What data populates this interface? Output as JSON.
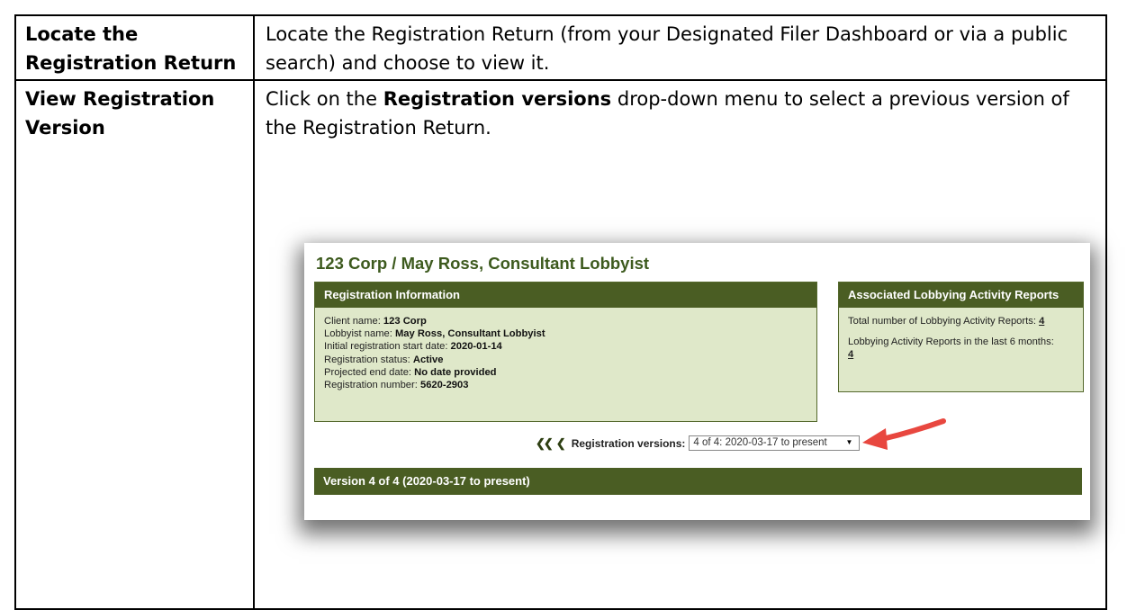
{
  "rows": [
    {
      "step": "Locate the Registration Return",
      "instruction": "Locate the Registration Return (from your Designated Filer Dashboard or via a public search) and choose to view it."
    },
    {
      "step": "View Registration Version",
      "instruction_pre": "Click on the ",
      "instruction_bold": "Registration versions",
      "instruction_post": " drop-down menu to select a previous version of the Registration Return."
    }
  ],
  "screenshot": {
    "title": "123 Corp / May Ross, Consultant Lobbyist",
    "registration_panel": {
      "heading": "Registration Information",
      "fields": [
        {
          "label": "Client name: ",
          "value": "123 Corp"
        },
        {
          "label": "Lobbyist name: ",
          "value": "May Ross, Consultant Lobbyist"
        },
        {
          "label": "Initial registration start date: ",
          "value": "2020-01-14"
        },
        {
          "label": "Registration status: ",
          "value": "Active"
        },
        {
          "label": "Projected end date: ",
          "value": "No date provided"
        },
        {
          "label": "Registration number: ",
          "value": "5620-2903"
        }
      ]
    },
    "associated_panel": {
      "heading": "Associated Lobbying Activity Reports",
      "total_label": "Total number of Lobbying Activity Reports: ",
      "total_value": "4",
      "recent_label": "Lobbying Activity Reports in the last 6 months: ",
      "recent_value": "4"
    },
    "versions": {
      "first_icon": "double-chevron-left-icon",
      "prev_icon": "chevron-left-icon",
      "label": "Registration versions:",
      "selected": "4 of 4: 2020-03-17 to present"
    },
    "version_heading": "Version 4 of 4 (2020-03-17 to present)"
  },
  "colors": {
    "panel_header": "#4a5d23",
    "panel_body": "#dfe8c9",
    "title_green": "#3d5a1e",
    "arrow_red": "#e8473f"
  }
}
